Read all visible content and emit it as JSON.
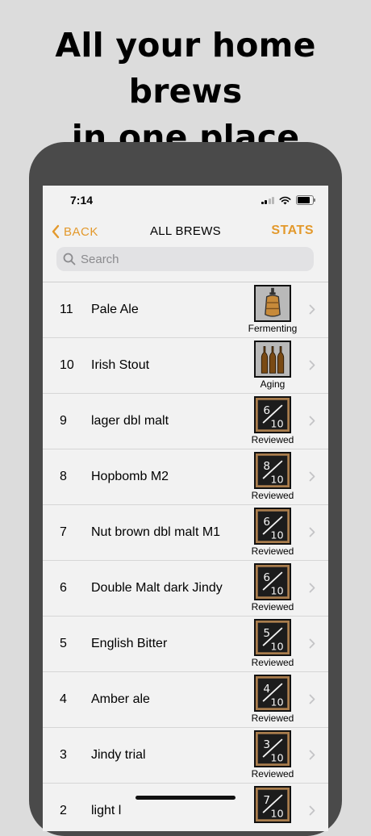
{
  "headline": {
    "line1": "All your home brews",
    "line2": "in one place"
  },
  "status_bar": {
    "time": "7:14"
  },
  "nav": {
    "back_label": "BACK",
    "title": "ALL BREWS",
    "stats_label": "STATS"
  },
  "search": {
    "placeholder": "Search"
  },
  "colors": {
    "accent": "#e3992c",
    "chalkboard": "#1c1c1c",
    "amber": "#c78a3a"
  },
  "brews": [
    {
      "num": "11",
      "name": "Pale Ale",
      "status": "Fermenting",
      "icon": "fermenter-icon",
      "score": ""
    },
    {
      "num": "10",
      "name": "Irish Stout",
      "status": "Aging",
      "icon": "bottles-icon",
      "score": ""
    },
    {
      "num": "9",
      "name": "lager dbl malt",
      "status": "Reviewed",
      "icon": "score-chalkboard-icon",
      "score": "6",
      "out_of": "10"
    },
    {
      "num": "8",
      "name": "Hopbomb M2",
      "status": "Reviewed",
      "icon": "score-chalkboard-icon",
      "score": "8",
      "out_of": "10"
    },
    {
      "num": "7",
      "name": "Nut brown dbl malt M1",
      "status": "Reviewed",
      "icon": "score-chalkboard-icon",
      "score": "6",
      "out_of": "10"
    },
    {
      "num": "6",
      "name": "Double Malt dark Jindy",
      "status": "Reviewed",
      "icon": "score-chalkboard-icon",
      "score": "6",
      "out_of": "10"
    },
    {
      "num": "5",
      "name": "English Bitter",
      "status": "Reviewed",
      "icon": "score-chalkboard-icon",
      "score": "5",
      "out_of": "10"
    },
    {
      "num": "4",
      "name": "Amber ale",
      "status": "Reviewed",
      "icon": "score-chalkboard-icon",
      "score": "4",
      "out_of": "10"
    },
    {
      "num": "3",
      "name": "Jindy trial",
      "status": "Reviewed",
      "icon": "score-chalkboard-icon",
      "score": "3",
      "out_of": "10"
    },
    {
      "num": "2",
      "name": "light l",
      "status": "",
      "icon": "score-chalkboard-icon",
      "score": "7",
      "out_of": "10"
    }
  ]
}
